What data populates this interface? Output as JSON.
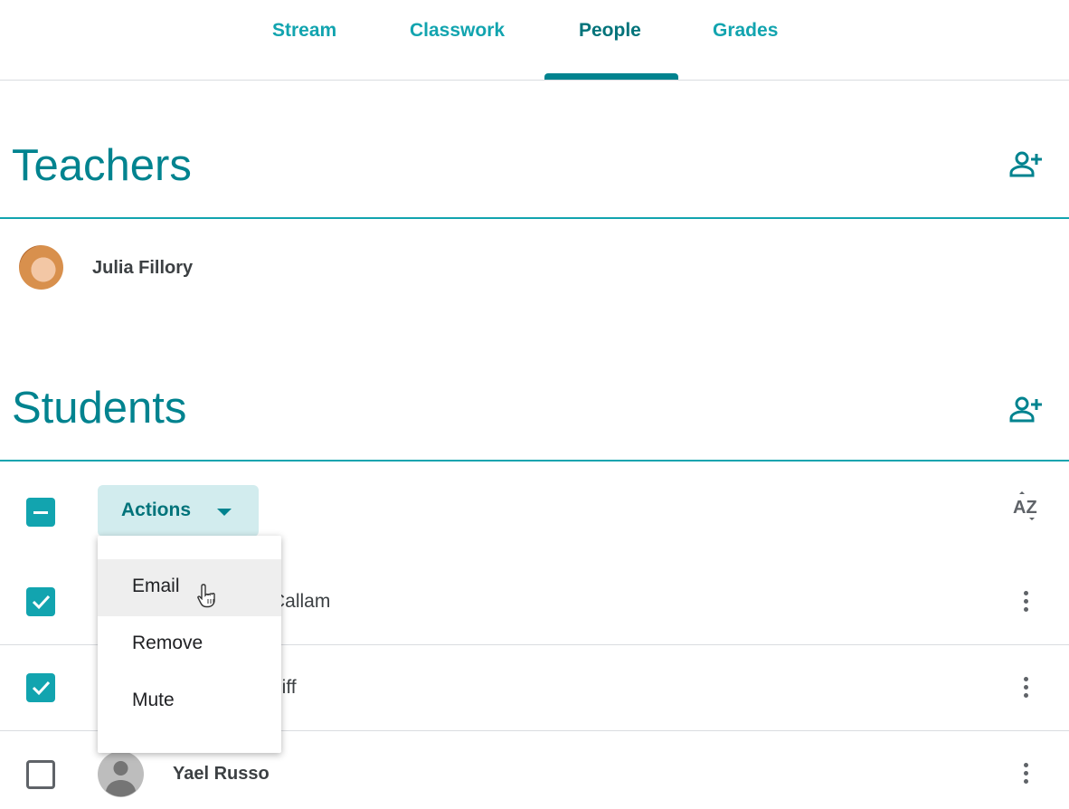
{
  "tabs": [
    {
      "label": "Stream"
    },
    {
      "label": "Classwork"
    },
    {
      "label": "People",
      "active": true
    },
    {
      "label": "Grades"
    }
  ],
  "teachers": {
    "heading": "Teachers",
    "items": [
      {
        "name": "Julia Fillory"
      }
    ]
  },
  "students": {
    "heading": "Students",
    "actions_label": "Actions",
    "menu": [
      {
        "label": "Email"
      },
      {
        "label": "Remove"
      },
      {
        "label": "Mute"
      }
    ],
    "rows": [
      {
        "visible_name": "Callam",
        "checked": true
      },
      {
        "visible_name": "liff",
        "checked": true
      },
      {
        "name": "Yael Russo",
        "checked": false
      }
    ]
  },
  "icons": {
    "add_person": "person-add-icon",
    "sort": "sort-az-icon",
    "more": "more-vert-icon",
    "cursor": "hand-pointer-icon"
  },
  "colors": {
    "accent": "#12a4af",
    "heading": "#00838f"
  }
}
